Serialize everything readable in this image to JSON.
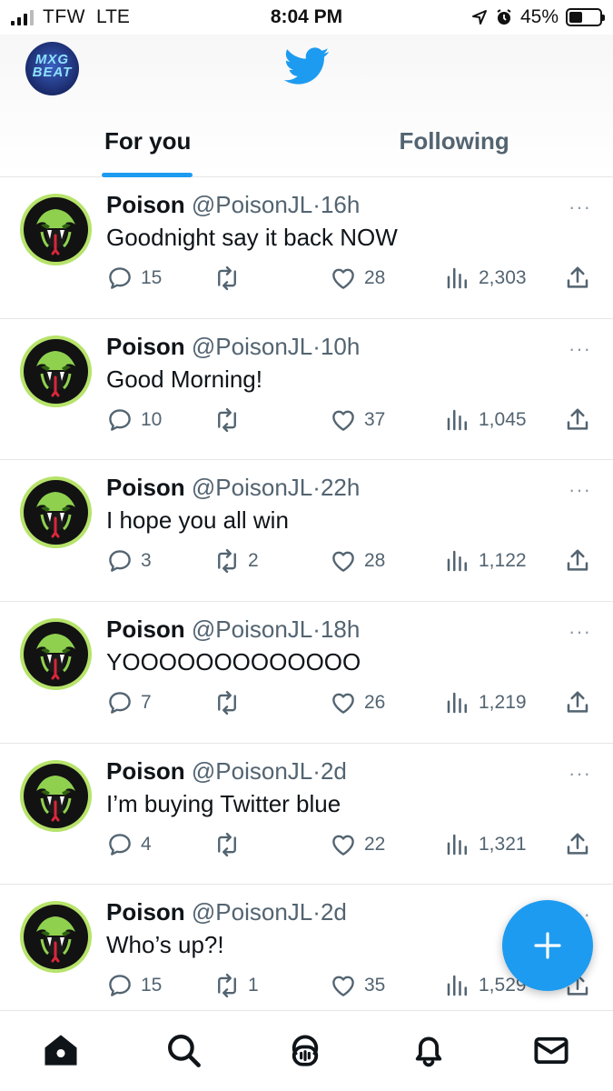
{
  "status_bar": {
    "carrier": "TFW",
    "network": "LTE",
    "time": "8:04 PM",
    "battery": "45%",
    "battery_level": 0.45,
    "icons": [
      "signal-icon",
      "location-icon",
      "alarm-icon",
      "battery-icon"
    ]
  },
  "header": {
    "profile_avatar_text": "MXG BEAT",
    "logo": "twitter-bird-icon",
    "tabs": [
      {
        "label": "For you",
        "active": true
      },
      {
        "label": "Following",
        "active": false
      }
    ]
  },
  "colors": {
    "accent": "#1d9bf0",
    "text": "#0f1419",
    "secondary_text": "#536471",
    "avatar_ring": "#b6e36a",
    "avatar_snake": "#8fd14f"
  },
  "tweets": [
    {
      "name": "Poison",
      "handle": "@PoisonJL",
      "time": "16h",
      "text": "Goodnight say it back NOW",
      "replies": "15",
      "retweets": "",
      "likes": "28",
      "views": "2,303"
    },
    {
      "name": "Poison",
      "handle": "@PoisonJL",
      "time": "10h",
      "text": "Good Morning!",
      "replies": "10",
      "retweets": "",
      "likes": "37",
      "views": "1,045"
    },
    {
      "name": "Poison",
      "handle": "@PoisonJL",
      "time": "22h",
      "text": "I hope you all win",
      "replies": "3",
      "retweets": "2",
      "likes": "28",
      "views": "1,122"
    },
    {
      "name": "Poison",
      "handle": "@PoisonJL",
      "time": "18h",
      "text": "YOOOOOOOOOOOOO",
      "replies": "7",
      "retweets": "",
      "likes": "26",
      "views": "1,219"
    },
    {
      "name": "Poison",
      "handle": "@PoisonJL",
      "time": "2d",
      "text": "I’m buying Twitter blue",
      "replies": "4",
      "retweets": "",
      "likes": "22",
      "views": "1,321"
    },
    {
      "name": "Poison",
      "handle": "@PoisonJL",
      "time": "2d",
      "text": "Who’s up?!",
      "replies": "15",
      "retweets": "1",
      "likes": "35",
      "views": "1,529"
    }
  ],
  "more_icon": "···",
  "fab_icon": "plus-icon",
  "tab_bar": [
    "home-icon",
    "search-icon",
    "spaces-icon",
    "notifications-icon",
    "messages-icon"
  ]
}
